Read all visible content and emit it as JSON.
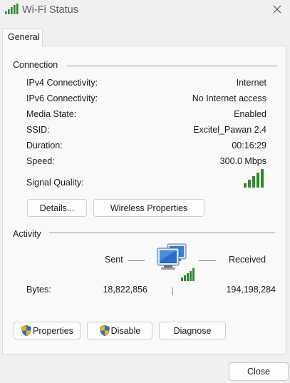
{
  "window": {
    "title": "Wi-Fi Status",
    "title_icon": "wifi-signal-icon",
    "close_icon": "close-icon"
  },
  "tabs": [
    {
      "label": "General",
      "selected": true
    }
  ],
  "connection": {
    "title": "Connection",
    "rows": [
      {
        "label": "IPv4 Connectivity:",
        "value": "Internet"
      },
      {
        "label": "IPv6 Connectivity:",
        "value": "No Internet access"
      },
      {
        "label": "Media State:",
        "value": "Enabled"
      },
      {
        "label": "SSID:",
        "value": "Excitel_Pawan 2.4"
      },
      {
        "label": "Duration:",
        "value": "00:16:29"
      },
      {
        "label": "Speed:",
        "value": "300.0 Mbps"
      }
    ],
    "signal_label": "Signal Quality:",
    "signal_bars": 5,
    "signal_bars_max": 5,
    "signal_color": "#2e8b2e",
    "details_button": "Details...",
    "wireless_button": "Wireless Properties"
  },
  "activity": {
    "title": "Activity",
    "sent_label": "Sent",
    "received_label": "Received",
    "bytes_label": "Bytes:",
    "bytes_sent": "18,822,856",
    "bytes_received": "194,198,284",
    "network_icon": "network-computers-icon"
  },
  "buttons": {
    "properties": "Properties",
    "disable": "Disable",
    "diagnose": "Diagnose",
    "close": "Close",
    "shield_icon": "uac-shield-icon"
  }
}
